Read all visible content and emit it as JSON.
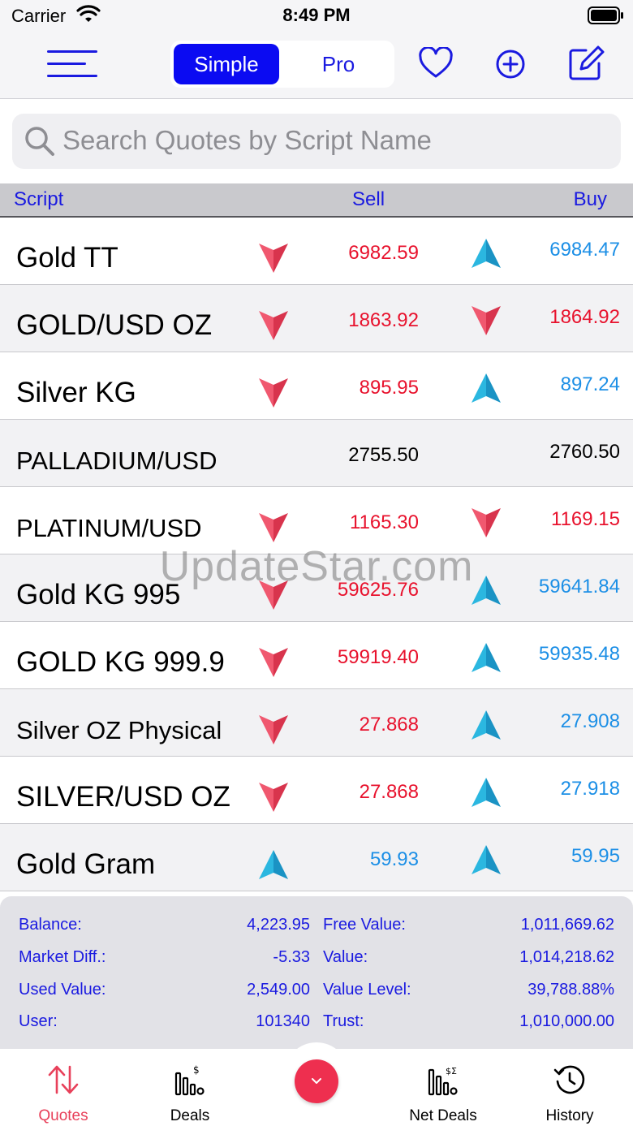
{
  "status_bar": {
    "carrier": "Carrier",
    "time": "8:49 PM"
  },
  "header": {
    "mode_options": [
      "Simple",
      "Pro"
    ],
    "selected_mode": "Simple",
    "icons": [
      "menu-icon",
      "heart-icon",
      "plus-circle-icon",
      "edit-icon"
    ]
  },
  "search": {
    "placeholder": "Search Quotes by Script Name",
    "value": ""
  },
  "columns": {
    "script": "Script",
    "sell": "Sell",
    "buy": "Buy"
  },
  "rows": [
    {
      "name": "Gold TT",
      "sell": "6982.59",
      "sell_dir": "down",
      "buy": "6984.47",
      "buy_dir": "up"
    },
    {
      "name": "GOLD/USD OZ",
      "sell": "1863.92",
      "sell_dir": "down",
      "buy": "1864.92",
      "buy_dir": "down"
    },
    {
      "name": "Silver KG",
      "sell": "895.95",
      "sell_dir": "down",
      "buy": "897.24",
      "buy_dir": "up"
    },
    {
      "name": "PALLADIUM/USD",
      "sell": "2755.50",
      "sell_dir": "none",
      "buy": "2760.50",
      "buy_dir": "none"
    },
    {
      "name": "PLATINUM/USD",
      "sell": "1165.30",
      "sell_dir": "down",
      "buy": "1169.15",
      "buy_dir": "down"
    },
    {
      "name": "Gold KG 995",
      "sell": "59625.76",
      "sell_dir": "down",
      "buy": "59641.84",
      "buy_dir": "up"
    },
    {
      "name": "GOLD KG 999.9",
      "sell": "59919.40",
      "sell_dir": "down",
      "buy": "59935.48",
      "buy_dir": "up"
    },
    {
      "name": "Silver OZ Physical",
      "sell": "27.868",
      "sell_dir": "down",
      "buy": "27.908",
      "buy_dir": "up"
    },
    {
      "name": "SILVER/USD OZ",
      "sell": "27.868",
      "sell_dir": "down",
      "buy": "27.918",
      "buy_dir": "up"
    },
    {
      "name": "Gold Gram",
      "sell": "59.93",
      "sell_dir": "up",
      "buy": "59.95",
      "buy_dir": "up"
    }
  ],
  "watermark": "UpdateStar.com",
  "summary": {
    "balance_label": "Balance:",
    "balance": "4,223.95",
    "free_value_label": "Free Value:",
    "free_value": "1,011,669.62",
    "market_diff_label": "Market Diff.:",
    "market_diff": "-5.33",
    "value_label": "Value:",
    "value": "1,014,218.62",
    "used_value_label": "Used Value:",
    "used_value": "2,549.00",
    "value_level_label": "Value Level:",
    "value_level": "39,788.88%",
    "user_label": "User:",
    "user": "101340",
    "trust_label": "Trust:",
    "trust": "1,010,000.00"
  },
  "tabbar": {
    "tabs": [
      {
        "label": "Quotes",
        "icon": "up-down-arrows-icon",
        "active": true
      },
      {
        "label": "Deals",
        "icon": "deals-chart-icon",
        "active": false
      },
      {
        "label": "",
        "icon": "chevron-down-icon",
        "active": false
      },
      {
        "label": "Net Deals",
        "icon": "net-deals-chart-icon",
        "active": false
      },
      {
        "label": "History",
        "icon": "history-clock-icon",
        "active": false
      }
    ]
  },
  "colors": {
    "accent_blue": "#0b0bf2",
    "text_blue": "#1a1ae0",
    "price_red": "#e8122d",
    "price_blue": "#1c8fe6",
    "arrow_red": "#e8405a",
    "arrow_teal": "#2bb7e0",
    "center_button": "#ee2f4f"
  }
}
